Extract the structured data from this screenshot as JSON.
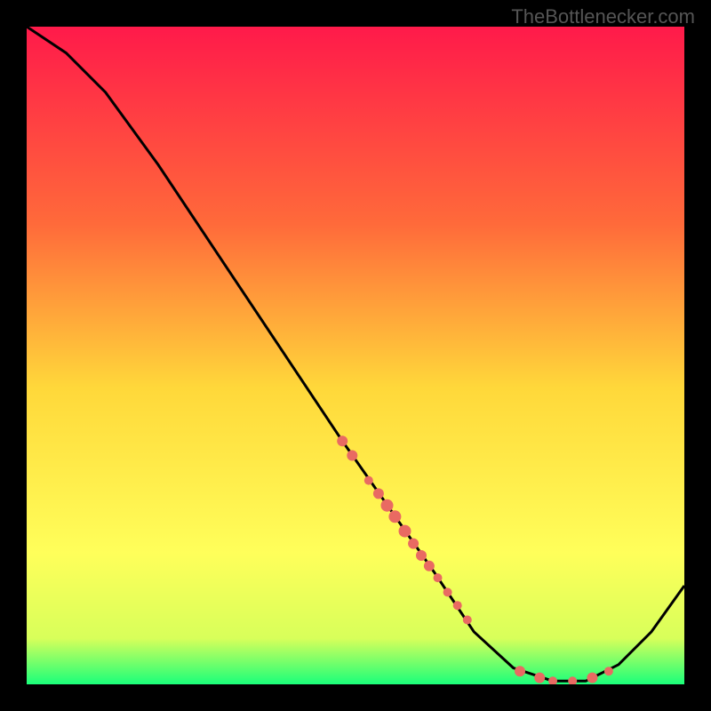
{
  "watermark": "TheBottlenecker.com",
  "gradient": {
    "top": "#ff1a4a",
    "mid1": "#ff6a3a",
    "mid2": "#ffd83a",
    "mid3": "#ffff5a",
    "mid4": "#d8ff5a",
    "bottom": "#1aff7a"
  },
  "chart_data": {
    "type": "line",
    "title": "",
    "xlabel": "",
    "ylabel": "",
    "xlim": [
      0,
      100
    ],
    "ylim": [
      0,
      100
    ],
    "curve": [
      {
        "x": 0,
        "y": 100
      },
      {
        "x": 6,
        "y": 96
      },
      {
        "x": 12,
        "y": 90
      },
      {
        "x": 20,
        "y": 79
      },
      {
        "x": 30,
        "y": 64
      },
      {
        "x": 40,
        "y": 49
      },
      {
        "x": 48,
        "y": 37
      },
      {
        "x": 55,
        "y": 27
      },
      {
        "x": 62,
        "y": 17
      },
      {
        "x": 68,
        "y": 8
      },
      {
        "x": 74,
        "y": 2.5
      },
      {
        "x": 80,
        "y": 0.5
      },
      {
        "x": 85,
        "y": 0.5
      },
      {
        "x": 90,
        "y": 3
      },
      {
        "x": 95,
        "y": 8
      },
      {
        "x": 100,
        "y": 15
      }
    ],
    "markers": [
      {
        "x": 48,
        "y": 37,
        "r": 6
      },
      {
        "x": 49.5,
        "y": 34.8,
        "r": 6
      },
      {
        "x": 52,
        "y": 31,
        "r": 5
      },
      {
        "x": 53.5,
        "y": 29,
        "r": 6
      },
      {
        "x": 54.8,
        "y": 27.2,
        "r": 7
      },
      {
        "x": 56,
        "y": 25.5,
        "r": 7
      },
      {
        "x": 57.5,
        "y": 23.3,
        "r": 7
      },
      {
        "x": 58.8,
        "y": 21.4,
        "r": 6
      },
      {
        "x": 60,
        "y": 19.6,
        "r": 6
      },
      {
        "x": 61.2,
        "y": 18,
        "r": 6
      },
      {
        "x": 62.5,
        "y": 16.2,
        "r": 5
      },
      {
        "x": 64,
        "y": 14,
        "r": 5
      },
      {
        "x": 65.5,
        "y": 12,
        "r": 5
      },
      {
        "x": 67,
        "y": 9.8,
        "r": 5
      },
      {
        "x": 75,
        "y": 2,
        "r": 6
      },
      {
        "x": 78,
        "y": 1,
        "r": 6
      },
      {
        "x": 80,
        "y": 0.5,
        "r": 5
      },
      {
        "x": 83,
        "y": 0.5,
        "r": 5
      },
      {
        "x": 86,
        "y": 1,
        "r": 6
      },
      {
        "x": 88.5,
        "y": 2,
        "r": 5
      }
    ]
  }
}
